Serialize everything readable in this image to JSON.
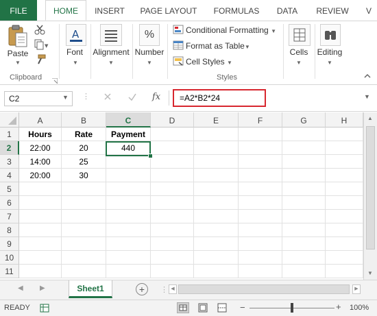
{
  "ribbon_tabs": [
    "FILE",
    "HOME",
    "INSERT",
    "PAGE LAYOUT",
    "FORMULAS",
    "DATA",
    "REVIEW",
    "V"
  ],
  "clipboard": {
    "paste": "Paste",
    "group": "Clipboard"
  },
  "home": {
    "font": "Font",
    "alignment": "Alignment",
    "number": "Number",
    "number_symbol": "%",
    "conditional_formatting": "Conditional Formatting",
    "format_as_table": "Format as Table",
    "cell_styles": "Cell Styles",
    "styles_group": "Styles",
    "cells": "Cells",
    "editing": "Editing"
  },
  "formula_bar": {
    "name_box": "C2",
    "fx": "fx",
    "formula": "=A2*B2*24"
  },
  "grid": {
    "columns": [
      "A",
      "B",
      "C",
      "D",
      "E",
      "F",
      "G",
      "H"
    ],
    "rows": [
      "1",
      "2",
      "3",
      "4",
      "5",
      "6",
      "7",
      "8",
      "9",
      "10",
      "11"
    ],
    "cells": {
      "A1": "Hours",
      "B1": "Rate",
      "C1": "Payment",
      "A2": "22:00",
      "B2": "20",
      "C2": "440",
      "A3": "14:00",
      "B3": "25",
      "A4": "20:00",
      "B4": "30"
    },
    "selected_cell": "C2"
  },
  "sheets": {
    "active": "Sheet1"
  },
  "status": {
    "mode": "READY",
    "zoom": "100%"
  },
  "colors": {
    "accent": "#217346",
    "highlight_border": "#d7262e"
  }
}
